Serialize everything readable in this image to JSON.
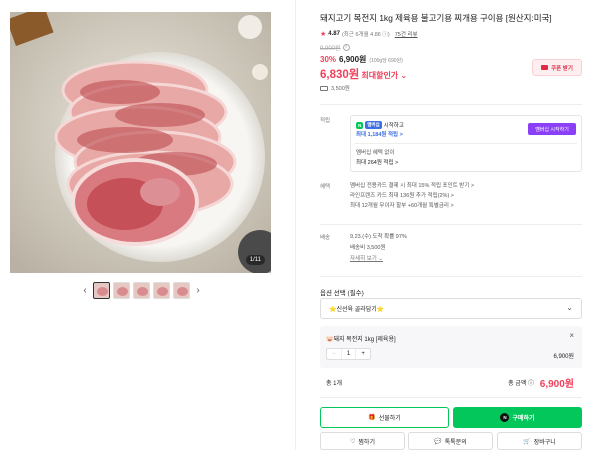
{
  "gallery": {
    "counter": "1/11",
    "prev_icon": "chevron-left-icon",
    "next_icon": "chevron-right-icon",
    "thumbnails": 5
  },
  "product": {
    "title": "돼지고기 목전지 1kg 제육용 불고기용 찌개용 구이용 [원산지:미국]",
    "rating_score": "4.87",
    "rating_note": "(최근 6개월 4.86 ⓘ)",
    "review_link": "75건 리뷰",
    "original_price": "9,900원",
    "discount_rate": "30%",
    "sale_price": "6,900원",
    "unit_price": "(100g당 690원)",
    "max_benefit_price": "6,830원",
    "max_benefit_label": "최대할인가 ⌄",
    "coupon_label": "쿠폰 받기",
    "delivery_fee": "3,500원"
  },
  "points": {
    "label": "적립",
    "np_badge": "N",
    "membership_badge": "멤버십",
    "start_text": "시작하고",
    "max_points": "최대 1,184원 적립 >",
    "membership_button": "멤버십 시작하기",
    "no_membership_text": "멤버십 혜택 없이",
    "no_membership_points": "최대 264원 적립 >"
  },
  "benefits": {
    "label": "혜택",
    "lines": [
      "멤버십 전용카드 결제 시 최대 15% 적립 포인트 받기 >",
      "라인프렌즈 카드 최대 136원 추가 적립(2%) >",
      "최대 12개월 무이자 할부 +60개월 특별금리 >"
    ]
  },
  "shipping": {
    "label": "배송",
    "line1": "9.23.(수) 도착 확률 97%",
    "line2": "배송비 3,500원",
    "link": "자세히 보기 ⌄"
  },
  "options": {
    "label": "옵션 선택 (필수)",
    "selected_value": "⭐신선육 골라담기⭐",
    "item_name": "🐷돼지 목전지 1kg [제육용]",
    "quantity": "1",
    "item_price": "6,900원",
    "minus": "−",
    "plus": "+",
    "close": "×"
  },
  "total": {
    "count": "총 1개",
    "label": "총 금액 ⓘ",
    "amount": "6,900원"
  },
  "actions": {
    "gift": "선물하기",
    "buy": "구매하기",
    "npay": "N",
    "wish": "찜하기",
    "talk": "톡톡문의",
    "cart": "장바구니"
  },
  "colors": {
    "accent_red": "#f23f5a",
    "naver_green": "#03c75a",
    "membership_purple": "#8b3ff6",
    "points_blue": "#3b6fe6"
  }
}
